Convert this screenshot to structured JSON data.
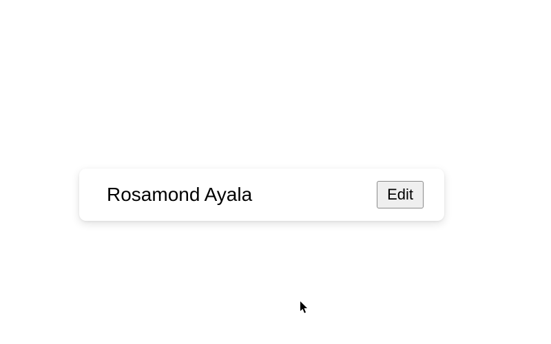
{
  "card": {
    "name": "Rosamond Ayala",
    "edit_label": "Edit"
  }
}
